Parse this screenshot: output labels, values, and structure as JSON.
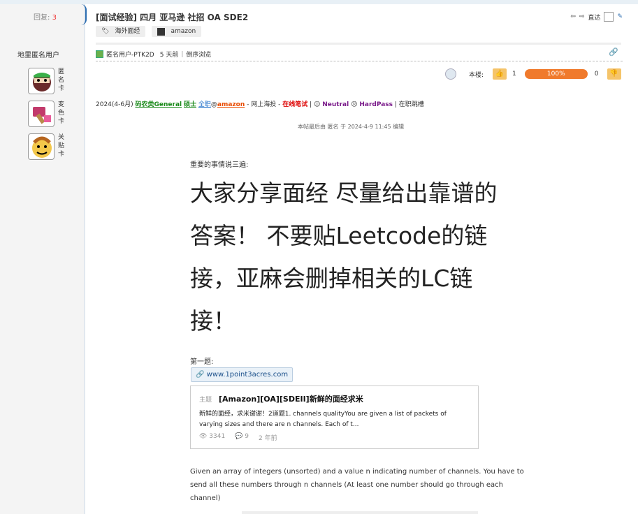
{
  "sidebar": {
    "reply_label": "回复:",
    "reply_count": "3",
    "anon_title": "地里匿名用户",
    "cards": [
      {
        "label": "匿名卡"
      },
      {
        "label": "变色卡"
      },
      {
        "label": "关贴卡"
      }
    ]
  },
  "post": {
    "title": "[面试经验] 四月 亚马逊 社招 OA SDE2",
    "tags": [
      "海外面经",
      "amazon"
    ],
    "top_right": {
      "direct_label": "直达"
    },
    "meta": {
      "user": "匿名用户-PTK2D",
      "time": "5 天前",
      "order_link": "倒序浏览"
    },
    "vote": {
      "floor_label": "本楼:",
      "up_count": "1",
      "percent": "100%",
      "down_count": "0"
    },
    "info": {
      "date": "2024(4-6月)",
      "category": "码农类General",
      "degree": "硕士",
      "type": "全职",
      "at": "@",
      "company": "amazon",
      "source_sep": " - 网上海投 - ",
      "stage": "在线笔试",
      "sep1": " | ",
      "neutral": "Neutral",
      "hard": "HardPass",
      "sep2": " | 在职跳槽"
    },
    "edited": "本帖最后由 匿名 于 2024-4-9 11:45 编辑",
    "important": "重要的事情说三遍:",
    "big_lines": [
      "大家分享面经 尽量给出靠谱的",
      "答案！ 不要贴Leetcode的链",
      "接，亚麻会删掉相关的LC链",
      "接！"
    ],
    "first_question": "第一题:",
    "url_chip": "www.1point3acres.com",
    "ref_card": {
      "label": "主题",
      "title": "[Amazon][OA][SDEII]新鲜的面经求米",
      "excerpt": "新鲜的面经，求米谢谢！2道题1. channels qualityYou are given a list of packets of varying sizes and there are n channels. Each of t...",
      "views": "3341",
      "replies": "9",
      "age": "2 年前"
    },
    "paragraph": "Given an array of integers (unsorted) and a value n indicating number of channels. You have to send all these numbers through n channels (At least one number should go through each channel)"
  }
}
